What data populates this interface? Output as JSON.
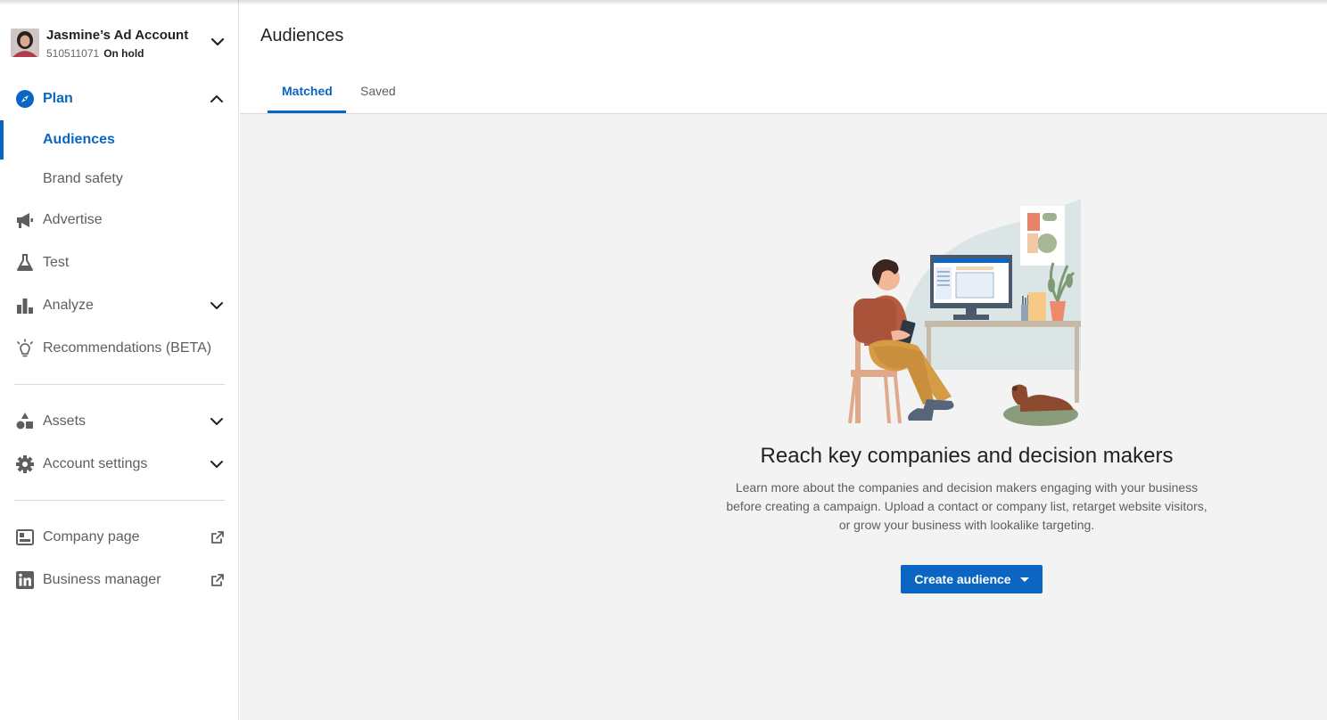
{
  "account": {
    "name": "Jasmine’s Ad Account",
    "id": "510511071",
    "status": "On hold"
  },
  "sidebar": {
    "plan": {
      "label": "Plan",
      "icon": "compass-icon",
      "expanded": true,
      "items": [
        {
          "label": "Audiences",
          "selected": true
        },
        {
          "label": "Brand safety",
          "selected": false
        }
      ]
    },
    "items": [
      {
        "label": "Advertise",
        "icon": "megaphone-icon"
      },
      {
        "label": "Test",
        "icon": "flask-icon"
      },
      {
        "label": "Analyze",
        "icon": "bar-chart-icon"
      },
      {
        "label": "Recommendations (BETA)",
        "icon": "lightbulb-icon"
      }
    ],
    "group2": [
      {
        "label": "Assets",
        "icon": "shapes-icon"
      },
      {
        "label": "Account settings",
        "icon": "gear-icon"
      }
    ],
    "links": [
      {
        "label": "Company page",
        "icon": "company-page-icon"
      },
      {
        "label": "Business manager",
        "icon": "linkedin-icon"
      }
    ]
  },
  "header": {
    "title": "Audiences",
    "tabs": [
      {
        "label": "Matched",
        "active": true
      },
      {
        "label": "Saved",
        "active": false
      }
    ]
  },
  "empty_state": {
    "title": "Reach key companies and decision makers",
    "description_lines": [
      "Learn more about the companies and decision makers engaging with your business",
      "before creating a campaign. Upload a contact or company list, retarget website visitors,",
      "or grow your business with lookalike targeting."
    ],
    "button_label": "Create audience"
  },
  "colors": {
    "accent": "#0a66c2",
    "background": "#f3f3f3",
    "text_muted": "#5e5e5e"
  }
}
